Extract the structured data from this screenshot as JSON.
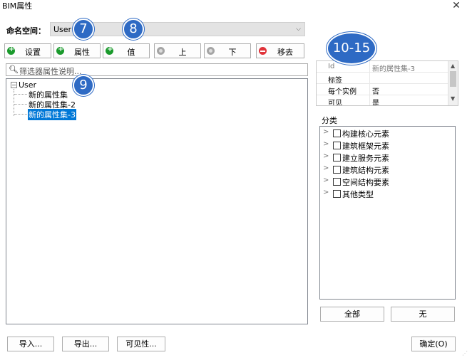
{
  "window": {
    "title": "BIM属性",
    "close_glyph": "✕"
  },
  "namespace": {
    "label": "命名空间：",
    "value": "User",
    "arrow": "⌵"
  },
  "toolbar": {
    "settings_label": "设置",
    "property_label": "属性",
    "value_label": "值",
    "up_label": "上",
    "down_label": "下",
    "remove_label": "移去"
  },
  "search": {
    "placeholder": "筛选器属性说明..."
  },
  "tree": {
    "root": "User",
    "root_toggle": "⊟",
    "children": [
      "新的属性集",
      "新的属性集-2",
      "新的属性集-3"
    ],
    "selected_index": 2
  },
  "properties": {
    "rows": [
      {
        "key": "Id",
        "value": "新的属性集-3"
      },
      {
        "key": "标签",
        "value": ""
      },
      {
        "key": "每个实例",
        "value": "否"
      },
      {
        "key": "可见",
        "value": "是"
      }
    ]
  },
  "categories": {
    "label": "分类",
    "items": [
      "构建核心元素",
      "建筑框架元素",
      "建立服务元素",
      "建筑结构元素",
      "空间结构要素",
      "其他类型"
    ]
  },
  "category_buttons": {
    "all_label": "全部",
    "none_label": "无"
  },
  "footer": {
    "import_label": "导入...",
    "export_label": "导出...",
    "visibility_label": "可见性...",
    "ok_label": "确定(O)"
  },
  "annotations": {
    "badge_7": "7",
    "badge_8": "8",
    "badge_9": "9",
    "badge_10_15": "10-15"
  },
  "colors": {
    "accent_blue": "#2e6ac4",
    "selection_blue": "#0078d7",
    "add_green": "#1a9a2c",
    "remove_red": "#e0333a"
  }
}
